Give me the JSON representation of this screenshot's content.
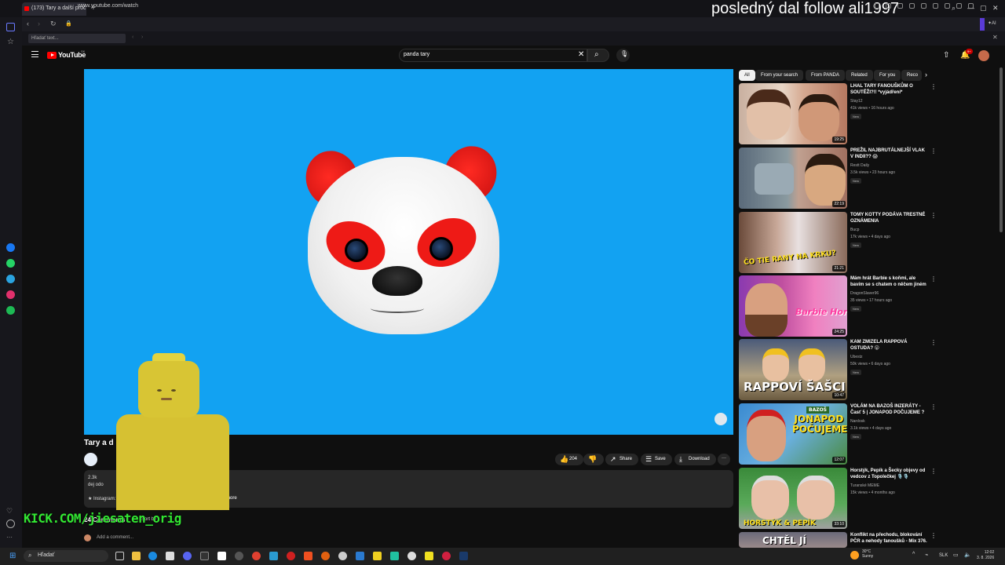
{
  "browser": {
    "tab_title": "(173) Tary a další proč",
    "new_tab": "+",
    "url": "www.youtube.com/watch",
    "find_placeholder": "Hľadať text..."
  },
  "stream_overlay": {
    "text": "posledný dal follow ali1997",
    "kick": "KICK.COM/jiesaten_orig"
  },
  "youtube": {
    "logo": "YouTube",
    "logo_country": "SK",
    "search_query": "panda tary",
    "notification_count": "9+"
  },
  "video": {
    "title": "Tary a d",
    "actions": {
      "like_count": "204",
      "share": "Share",
      "save": "Save",
      "download": "Download"
    },
    "description": {
      "line1": "2.3k",
      "line2": "dej odo",
      "line3": "★ Instagram: htt",
      "more": "...more"
    },
    "comments_count": "24 Comments",
    "sort_by": "Sort by",
    "add_comment": "Add a comment..."
  },
  "chips": [
    "All",
    "From your search",
    "From PANDA",
    "Related",
    "For you",
    "Reco"
  ],
  "recommendations": [
    {
      "title": "LHAL TARY FANOUŠKŮM O SOUTĚŽI?!! *vyjádření*",
      "channel": "Stay12",
      "meta": "41k views • 16 hours ago",
      "badge": "New",
      "duration": "19:25"
    },
    {
      "title": "PREŽIL NAJBRUTÁLNEJŠÍ VLAK V INDII?? 😱",
      "channel": "Restt Daily",
      "meta": "3.5k views • 23 hours ago",
      "badge": "New",
      "duration": "22:19"
    },
    {
      "title": "TOMY KOTTY PODÁVA TRESTNÉ OZNÁMENIA",
      "channel": "Bucp",
      "meta": "17k views • 4 days ago",
      "badge": "New",
      "duration": "21:21"
    },
    {
      "title": "Mám hrát Barbie s koňmi, ale bavím se s chatem o něčem jiném",
      "channel": "DragonSlaver96",
      "meta": "35 views • 17 hours ago",
      "badge": "New",
      "duration": "24:25"
    },
    {
      "title": "KAM ZMIZELA RAPPOVÁ OSTUDA? 😮",
      "channel": "Ubestz",
      "meta": "50k views • 6 days ago",
      "badge": "New",
      "duration": "10:47"
    },
    {
      "title": "VOLÁM NA BAZOŠ INZERÁTY - Časť 5 | JONAPOD POČUJEME ?",
      "channel": "Nardosk",
      "meta": "3.1k views • 4 days ago",
      "badge": "New",
      "duration": "12:07"
    },
    {
      "title": "Horstýk, Pepík a Šecky objevy od vedcov z Topolečkej 🎙️🎙️",
      "channel": "Turanské MEME",
      "meta": "15k views • 4 months ago",
      "badge": "",
      "duration": "33:10"
    },
    {
      "title": "Konflikt na přechodu, blokování PČR a nehody fanoušků - Mix 376.",
      "channel": "",
      "meta": "",
      "badge": "",
      "duration": ""
    }
  ],
  "thumb_texts": {
    "t3": "ČO TIE RANY NA KRKU?",
    "t4": "Barbie Horse Trails",
    "t5": "RAPPOVÍ ŠAŠCI",
    "t6": "JONAPOD POČUJEME",
    "t6b": "BAZOŠ",
    "t7": "HORSTÝK & PEPÍK",
    "t8": "CHTĚL JÍ"
  },
  "taskbar": {
    "search": "Hľadať",
    "weather_temp": "30°C",
    "weather_desc": "Sunny",
    "lang": "SLK",
    "time": "12:02",
    "date": "3. 8. 2026"
  },
  "colors": {
    "video_bg": "#12a2f2",
    "yt_red": "#ff0000",
    "kick_green": "#32e632",
    "panda_red": "#ee1a16"
  }
}
